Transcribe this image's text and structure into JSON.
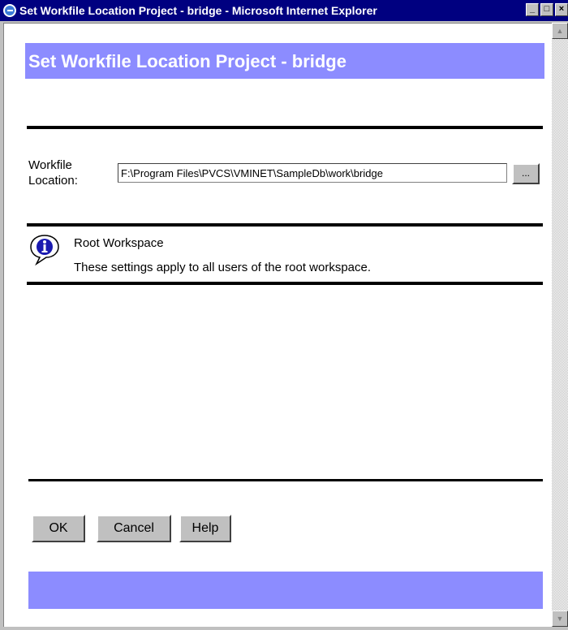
{
  "window": {
    "title": "Set Workfile Location Project - bridge - Microsoft Internet Explorer",
    "controls": [
      "minimize",
      "maximize",
      "close"
    ]
  },
  "page": {
    "heading": "Set Workfile Location Project - bridge"
  },
  "workfile": {
    "label": "Workfile Location:",
    "value": "F:\\Program Files\\PVCS\\VMINET\\SampleDb\\work\\bridge",
    "browse_label": "..."
  },
  "info": {
    "icon": "info-icon",
    "title": "Root Workspace",
    "text": "These settings apply to all users of the root workspace."
  },
  "buttons": {
    "ok": "OK",
    "cancel": "Cancel",
    "help": "Help"
  },
  "colors": {
    "titlebar": "#000080",
    "header_band": "#8c8cff",
    "chrome": "#c0c0c0"
  }
}
